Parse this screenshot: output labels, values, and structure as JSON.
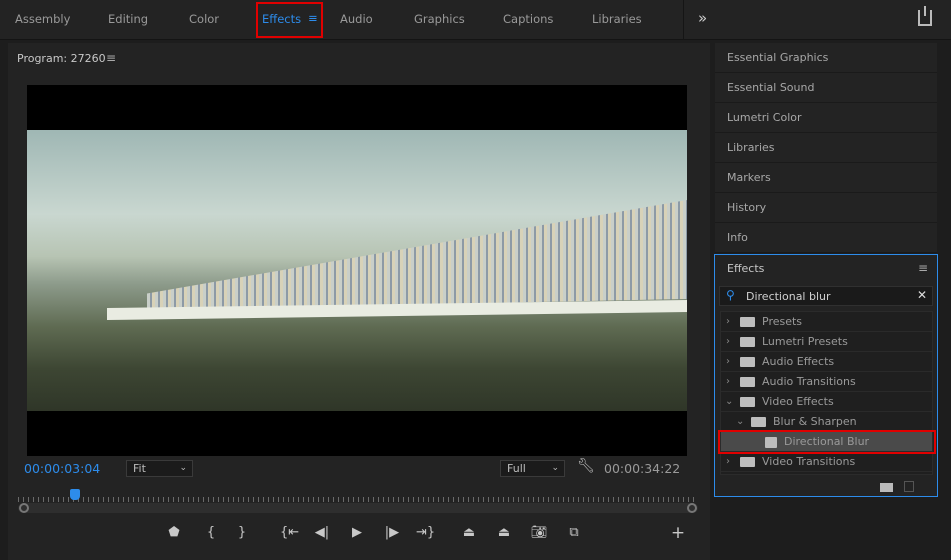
{
  "workspaces": [
    "Assembly",
    "Editing",
    "Color",
    "Effects",
    "Audio",
    "Graphics",
    "Captions",
    "Libraries"
  ],
  "active_workspace": "Effects",
  "overflow_icon": "»",
  "monitor": {
    "title": "Program: 27260",
    "timecode_current": "00:00:03:04",
    "zoom": "Fit",
    "resolution": "Full",
    "timecode_duration": "00:00:34:22",
    "playhead_fraction": 0.084
  },
  "controls": [
    "marker",
    "mark-in",
    "mark-out",
    "go-to-in",
    "step-back",
    "play",
    "step-forward",
    "go-to-out",
    "lift",
    "extract",
    "export-frame",
    "comparison-view",
    "add"
  ],
  "right_panels": [
    "Essential Graphics",
    "Essential Sound",
    "Lumetri Color",
    "Libraries",
    "Markers",
    "History",
    "Info"
  ],
  "effects": {
    "title": "Effects",
    "search_value": "Directional blur",
    "tree": [
      {
        "label": "Presets",
        "level": 0,
        "expanded": false,
        "icon": "preset-folder"
      },
      {
        "label": "Lumetri Presets",
        "level": 0,
        "expanded": false,
        "icon": "preset-folder"
      },
      {
        "label": "Audio Effects",
        "level": 0,
        "expanded": false,
        "icon": "folder"
      },
      {
        "label": "Audio Transitions",
        "level": 0,
        "expanded": false,
        "icon": "folder"
      },
      {
        "label": "Video Effects",
        "level": 0,
        "expanded": true,
        "icon": "folder"
      },
      {
        "label": "Blur & Sharpen",
        "level": 1,
        "expanded": true,
        "icon": "folder"
      },
      {
        "label": "Directional Blur",
        "level": 2,
        "selected": true,
        "icon": "effect"
      },
      {
        "label": "Video Transitions",
        "level": 0,
        "expanded": false,
        "icon": "folder"
      }
    ]
  },
  "colors": {
    "accent": "#2d8ceb",
    "highlight": "#e00000"
  }
}
